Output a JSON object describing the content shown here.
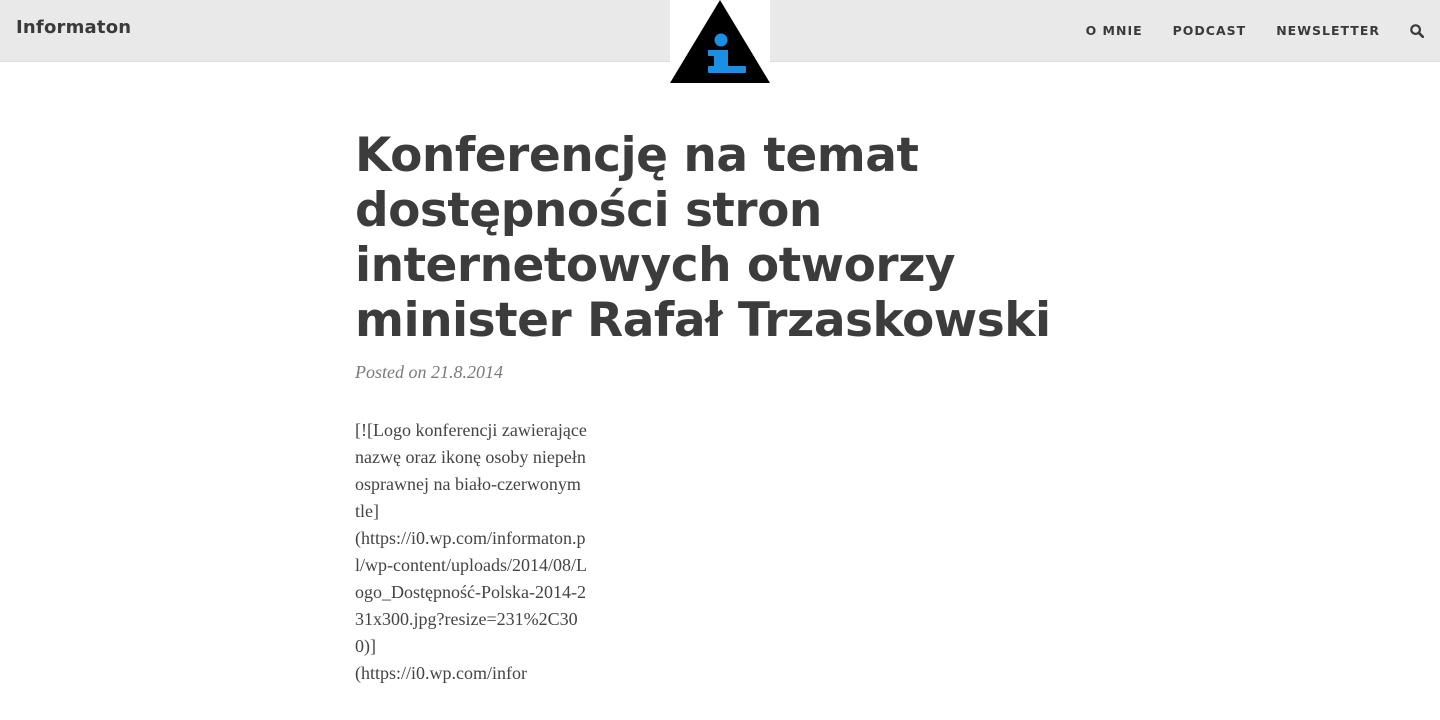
{
  "header": {
    "site_title": "Informaton",
    "logo": {
      "icon": "info-triangle-logo",
      "accent": "#1a8fe3",
      "shape_color": "#000000"
    },
    "nav": [
      {
        "label": "O MNIE"
      },
      {
        "label": "PODCAST"
      },
      {
        "label": "NEWSLETTER"
      }
    ],
    "search_icon": "search-icon"
  },
  "post": {
    "title": "Konferencję na temat dostępności stron internetowych otworzy minister Rafał Trzaskowski",
    "meta_prefix": "Posted on",
    "date": "21.8.2014",
    "content": "[![Logo konferencji zawierające nazwę oraz ikonę osoby niepełnosprawnej na biało-czerwonym tle]\n(https://i0.wp.com/informaton.pl/wp-content/uploads/2014/08/Logo_Dostępność-Polska-2014-231x300.jpg?resize=231%2C300)]\n(https://i0.wp.com/infor"
  },
  "colors": {
    "header_bg": "#e9e9e9",
    "text": "#3c3c3c",
    "meta": "#7a7a7a"
  }
}
